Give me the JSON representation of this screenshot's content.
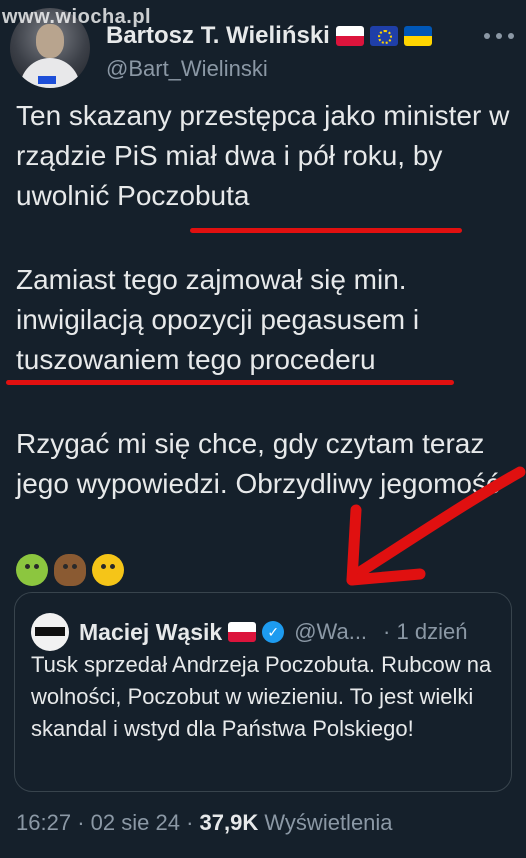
{
  "watermark": "www.wiocha.pl",
  "author": {
    "name": "Bartosz T. Wieliński",
    "handle": "@Bart_Wielinski",
    "flags": [
      "poland-flag",
      "eu-flag",
      "ukraine-flag"
    ]
  },
  "tweet": {
    "paragraph1": "Ten skazany przestępca jako minister w rządzie PiS miał dwa i pół roku, by uwolnić Poczobuta",
    "paragraph2": "Zamiast tego zajmował się min. inwigilacją opozycji pegasusem i tuszowaniem tego procederu",
    "paragraph3": "Rzygać mi się chce, gdy czytam teraz jego wypowiedzi. Obrzydliwy jegomość",
    "emojis": [
      "nauseated-face",
      "pile-of-poo",
      "face-vomiting"
    ]
  },
  "quoted": {
    "name": "Maciej Wąsik",
    "handle": "@Wa...",
    "time": "· 1 dzień",
    "text": "Tusk sprzedał Andrzeja Poczobuta. Rubcow na wolności, Poczobut w wiezieniu. To jest wielki skandal i wstyd dla Państwa Polskiego!"
  },
  "meta": {
    "time": "16:27",
    "date": "02 sie 24",
    "views": "37,9K",
    "views_label": "Wyświetlenia",
    "separator": "·"
  },
  "colors": {
    "background": "#15202b",
    "text": "#e7e9ea",
    "muted": "#8b98a5",
    "annotation_red": "#e01010",
    "verified_blue": "#1d9bf0"
  }
}
